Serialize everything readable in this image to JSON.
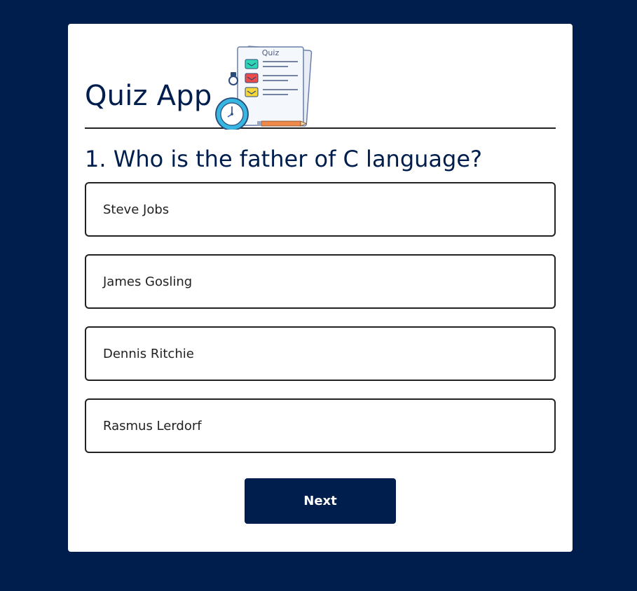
{
  "app": {
    "title": "Quiz App",
    "logo_text": "Quiz"
  },
  "question": {
    "text": "1. Who is the father of C language?"
  },
  "answers": [
    {
      "label": "Steve Jobs"
    },
    {
      "label": "James Gosling"
    },
    {
      "label": "Dennis Ritchie"
    },
    {
      "label": "Rasmus Lerdorf"
    }
  ],
  "controls": {
    "next_label": "Next"
  },
  "colors": {
    "background": "#001e4d",
    "card": "#ffffff",
    "primary": "#001e4d",
    "border": "#222222"
  },
  "icons": {
    "logo": "quiz-clipboard-stopwatch-icon"
  }
}
